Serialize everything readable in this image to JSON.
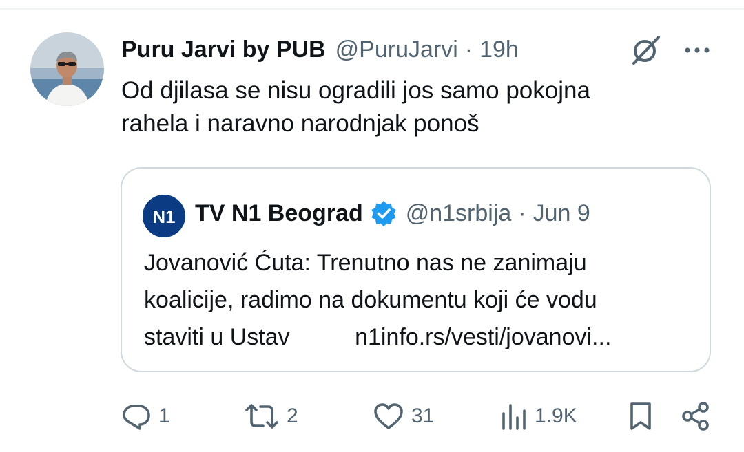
{
  "tweet": {
    "author": {
      "display_name": "Puru Jarvi by PUB",
      "handle": "@PuruJarvi",
      "time": "19h"
    },
    "separator": "·",
    "text": "Od djilasa se nisu ogradili jos samo pokojna\nrahela i naravno narodnjak ponoš",
    "icons": {
      "grok": "grok-icon",
      "more": "more-icon"
    }
  },
  "quote": {
    "logo_text": "N1",
    "author": {
      "display_name": "TV N1 Beograd",
      "handle": "@n1srbija",
      "date": "Jun 9",
      "verified": true
    },
    "separator": "·",
    "text": "Jovanović Ćuta: Trenutno nas ne zanimaju\nkoalicije, radimo na dokumentu koji će vodu\nstaviti u Ustav",
    "link": "n1info.rs/vesti/jovanovi..."
  },
  "actions": {
    "replies": "1",
    "reposts": "2",
    "likes": "31",
    "views": "1.9K",
    "icons": [
      "reply-icon",
      "repost-icon",
      "like-icon",
      "views-icon",
      "bookmark-icon",
      "share-icon"
    ]
  },
  "colors": {
    "text_primary": "#0f1419",
    "text_muted": "#536471",
    "border": "#cfd9de",
    "verified_blue": "#1d9bf0",
    "n1_navy": "#0a3b83"
  }
}
